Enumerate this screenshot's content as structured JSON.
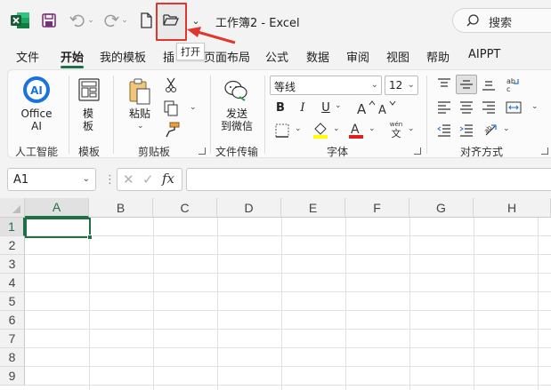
{
  "titlebar": {
    "title": "工作簿2  -  Excel",
    "search_label": "搜索",
    "tooltip": "打开"
  },
  "tabs": [
    {
      "label": "文件"
    },
    {
      "label": "开始"
    },
    {
      "label": "我的模板"
    },
    {
      "label": "插"
    },
    {
      "label": "页面布局"
    },
    {
      "label": "公式"
    },
    {
      "label": "数据"
    },
    {
      "label": "审阅"
    },
    {
      "label": "视图"
    },
    {
      "label": "帮助"
    },
    {
      "label": "AIPPT"
    }
  ],
  "ribbon": {
    "office_ai": "Office\nAI",
    "office_ai_line1": "Office",
    "office_ai_line2": "AI",
    "ai_badge": "AI",
    "template_line1": "模",
    "template_line2": "板",
    "paste": "粘贴",
    "send_line1": "发送",
    "send_line2": "到微信",
    "font_name": "等线",
    "font_size": "12",
    "bold": "B",
    "italic": "I",
    "underline": "U",
    "font_color_glyph": "A",
    "pinyin_top": "wén",
    "pinyin_char": "文",
    "groups": {
      "ai": "人工智能",
      "template": "模板",
      "clipboard": "剪贴板",
      "transfer": "文件传输",
      "font": "字体",
      "align": "对齐方式"
    },
    "colors": {
      "highlight": "#ffff00",
      "font_color": "#e02020",
      "accent": "#1e7145"
    }
  },
  "formula_bar": {
    "name_box": "A1",
    "fx": "fx",
    "value": ""
  },
  "grid": {
    "columns": [
      "A",
      "B",
      "C",
      "D",
      "E",
      "F",
      "G",
      "H"
    ],
    "rows": [
      "1",
      "2",
      "3",
      "4",
      "5",
      "6",
      "7",
      "8",
      "9"
    ],
    "active_cell": "A1"
  }
}
